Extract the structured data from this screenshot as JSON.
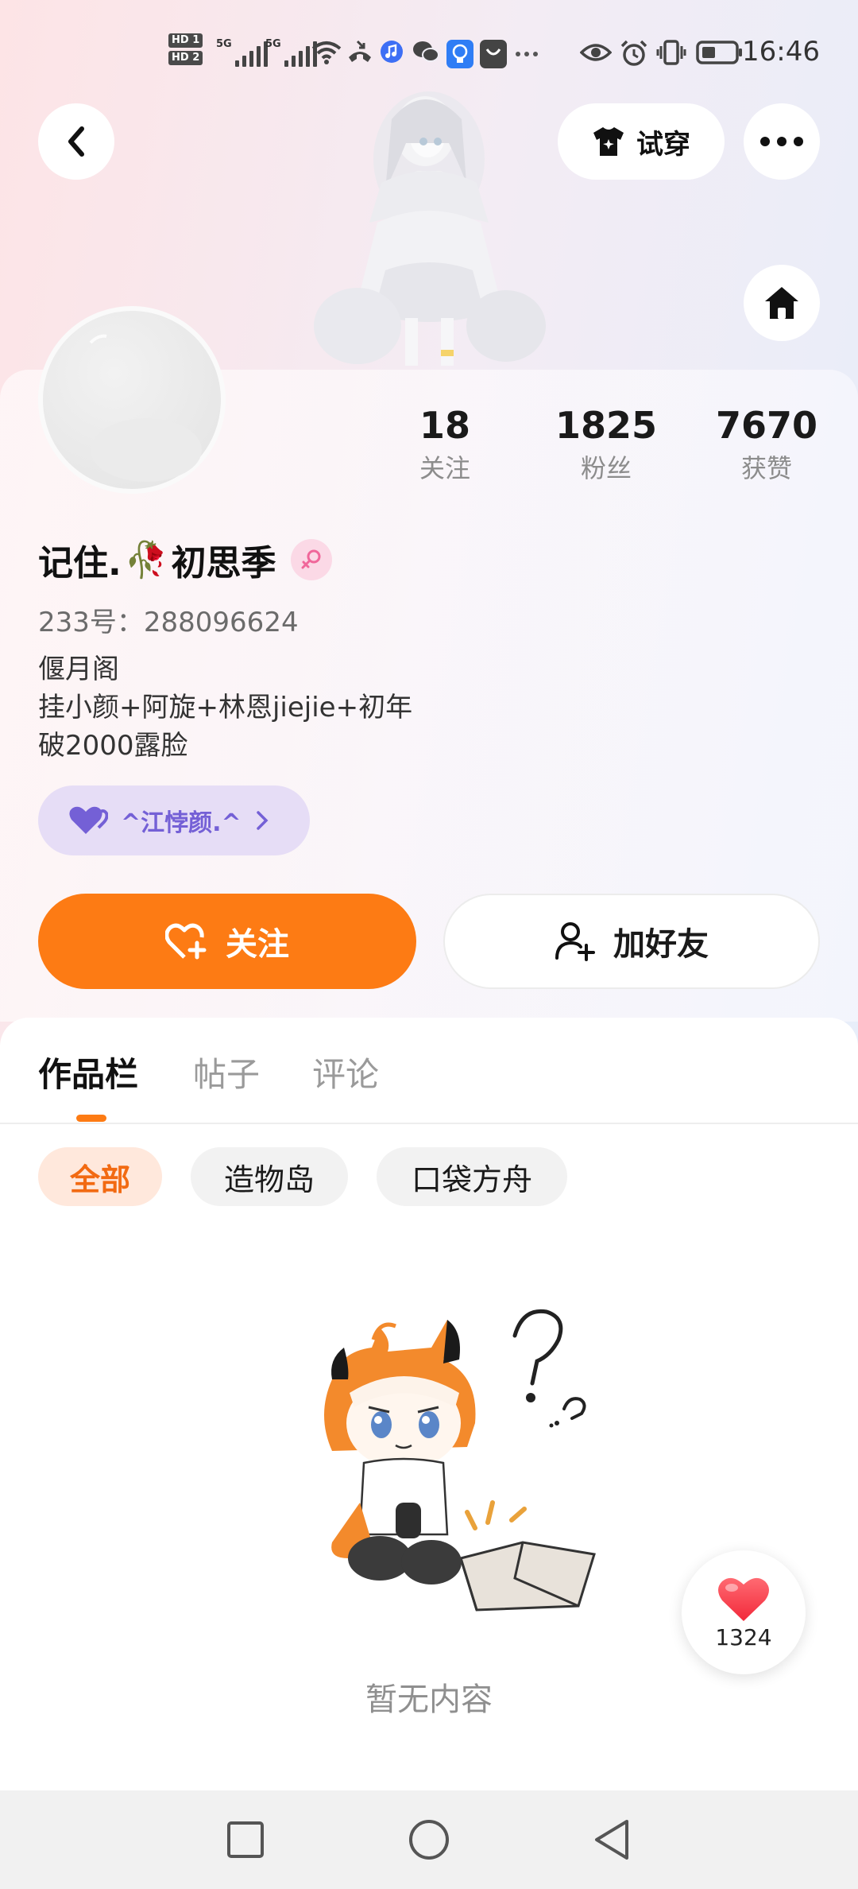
{
  "status_bar": {
    "time": "16:46",
    "hd_badges": [
      "HD 1",
      "HD 2"
    ],
    "network_1": "5G",
    "network_2": "5G",
    "icons": [
      "wifi-icon",
      "call-icon",
      "music-icon",
      "wechat-icon",
      "bulb-icon",
      "bag-icon",
      "more-dots-icon",
      "eye-icon",
      "alarm-icon",
      "vibrate-icon",
      "battery-icon"
    ]
  },
  "header": {
    "tryon_label": "试穿",
    "icons": [
      "back-arrow-icon",
      "shirt-icon",
      "more-icon",
      "home-icon"
    ]
  },
  "stats": [
    {
      "value": "18",
      "label": "关注"
    },
    {
      "value": "1825",
      "label": "粉丝"
    },
    {
      "value": "7670",
      "label": "获赞"
    }
  ],
  "profile": {
    "name_part1": "记住.",
    "name_emoji": "🥀",
    "name_part2": "初思季",
    "gender": "female",
    "uid_line": "233号：288096624",
    "bio": [
      "偃月阁",
      "挂小颜+阿旋+林恩jiejie+初年",
      "破2000露脸"
    ],
    "fan_badge_label": "^江悖颜.^"
  },
  "actions": {
    "follow_label": "关注",
    "add_friend_label": "加好友"
  },
  "tabs": [
    {
      "label": "作品栏",
      "active": true
    },
    {
      "label": "帖子",
      "active": false
    },
    {
      "label": "评论",
      "active": false
    }
  ],
  "filters": [
    {
      "label": "全部",
      "active": true
    },
    {
      "label": "造物岛",
      "active": false
    },
    {
      "label": "口袋方舟",
      "active": false
    }
  ],
  "empty_state": {
    "text": "暂无内容"
  },
  "like_fab": {
    "count": "1324"
  },
  "colors": {
    "accent": "#fd7b14",
    "badge_purple": "#7460d6",
    "heart_red": "#f73f48"
  },
  "nav_icons": [
    "recent-apps-icon",
    "home-circle-icon",
    "back-triangle-icon"
  ]
}
